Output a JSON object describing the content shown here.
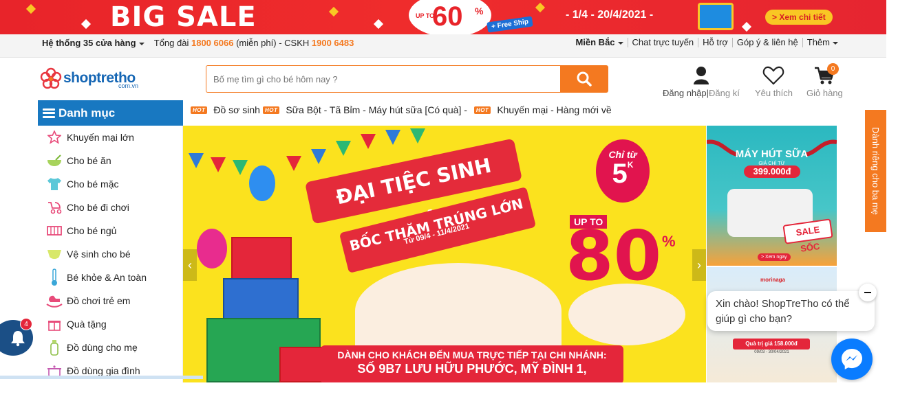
{
  "top_banner": {
    "headline": "BIG SALE",
    "up_to": "UP TO",
    "discount": "60",
    "percent": "%",
    "free_ship": "+ Free Ship",
    "dates": "- 1/4 - 20/4/2021 -",
    "cta": "> Xem chi tiết",
    "colors": {
      "background": "#e8242a",
      "accent": "#f9c724"
    }
  },
  "info_bar": {
    "stores": "Hệ thống 35 cửa hàng",
    "hotline_label": "Tổng đài",
    "hotline": "1800 6066",
    "hotline_note": "(miễn phí) - CSKH",
    "cskh": "1900 6483",
    "right_links": [
      "Miền Bắc",
      "Chat trực tuyến",
      "Hỗ trợ",
      "Góp ý & liên hệ",
      "Thêm"
    ]
  },
  "header": {
    "logo_text": "shoptretho",
    "logo_sub": "com.vn",
    "search_placeholder": "Bố mẹ tìm gì cho bé hôm nay ?",
    "login_label": "Đăng nhập",
    "register_label": "Đăng kí",
    "login_separator": "|",
    "wishlist_label": "Yêu thích",
    "cart_label": "Giỏ hàng",
    "cart_count": "0",
    "colors": {
      "brand_blue": "#1566b4",
      "orange": "#f47920"
    }
  },
  "categories": {
    "title": "Danh mục",
    "items": [
      {
        "label": "Khuyến mại lớn",
        "icon": "star-icon"
      },
      {
        "label": "Cho bé ăn",
        "icon": "bowl-icon"
      },
      {
        "label": "Cho bé mặc",
        "icon": "shirt-icon"
      },
      {
        "label": "Cho bé đi chơi",
        "icon": "stroller-icon"
      },
      {
        "label": "Cho bé ngủ",
        "icon": "crib-icon"
      },
      {
        "label": "Vệ sinh cho bé",
        "icon": "diaper-icon"
      },
      {
        "label": "Bé khỏe & An toàn",
        "icon": "thermometer-icon"
      },
      {
        "label": "Đồ chơi trẻ em",
        "icon": "rocking-horse-icon"
      },
      {
        "label": "Quà tặng",
        "icon": "gift-icon"
      },
      {
        "label": "Đồ dùng cho mẹ",
        "icon": "bottle-icon"
      },
      {
        "label": "Đồ dùng gia đình",
        "icon": "pot-icon"
      }
    ]
  },
  "hot_links": {
    "tag": "HOT",
    "items": [
      "Đồ sơ sinh",
      "Sữa Bột - Tã Bỉm - Máy hút sữa [Có quà] -",
      "Khuyến mại - Hàng mới về"
    ]
  },
  "main_banner": {
    "title": "ĐẠI TIỆC SINH NHẬT",
    "subtitle": "BỐC THĂM TRÚNG LỚN",
    "dates": "Từ 09/4 - 11/4/2021",
    "from_label": "Chỉ từ",
    "from_value": "5",
    "from_unit": "K",
    "up_to": "UP TO",
    "discount": "80",
    "percent": "%",
    "desc_line1": "DÀNH CHO KHÁCH ĐẾN MUA TRỰC TIẾP TẠI CHI NHÁNH:",
    "desc_line2": "SỐ 9B7 LƯU HỮU PHƯỚC, MỸ ĐÌNH 1,",
    "prev": "‹",
    "next": "›"
  },
  "side_ads": {
    "ad1": {
      "title": "MÁY HÚT SỮA",
      "price_label": "GIÁ CHỈ TỪ",
      "price": "399.000đ",
      "badge": "SALE SỐC",
      "cta": "> Xem ngay"
    },
    "ad2": {
      "brand": "morinaga",
      "price": "Quà trị giá 158.000đ",
      "dates": "09/03 - 30/04/2021"
    }
  },
  "side_tab": {
    "label": "Dành riêng cho ba mẹ"
  },
  "chat": {
    "greeting": "Xin chào! ShopTreTho có thể giúp gì cho bạn?",
    "notification_count": "4"
  }
}
